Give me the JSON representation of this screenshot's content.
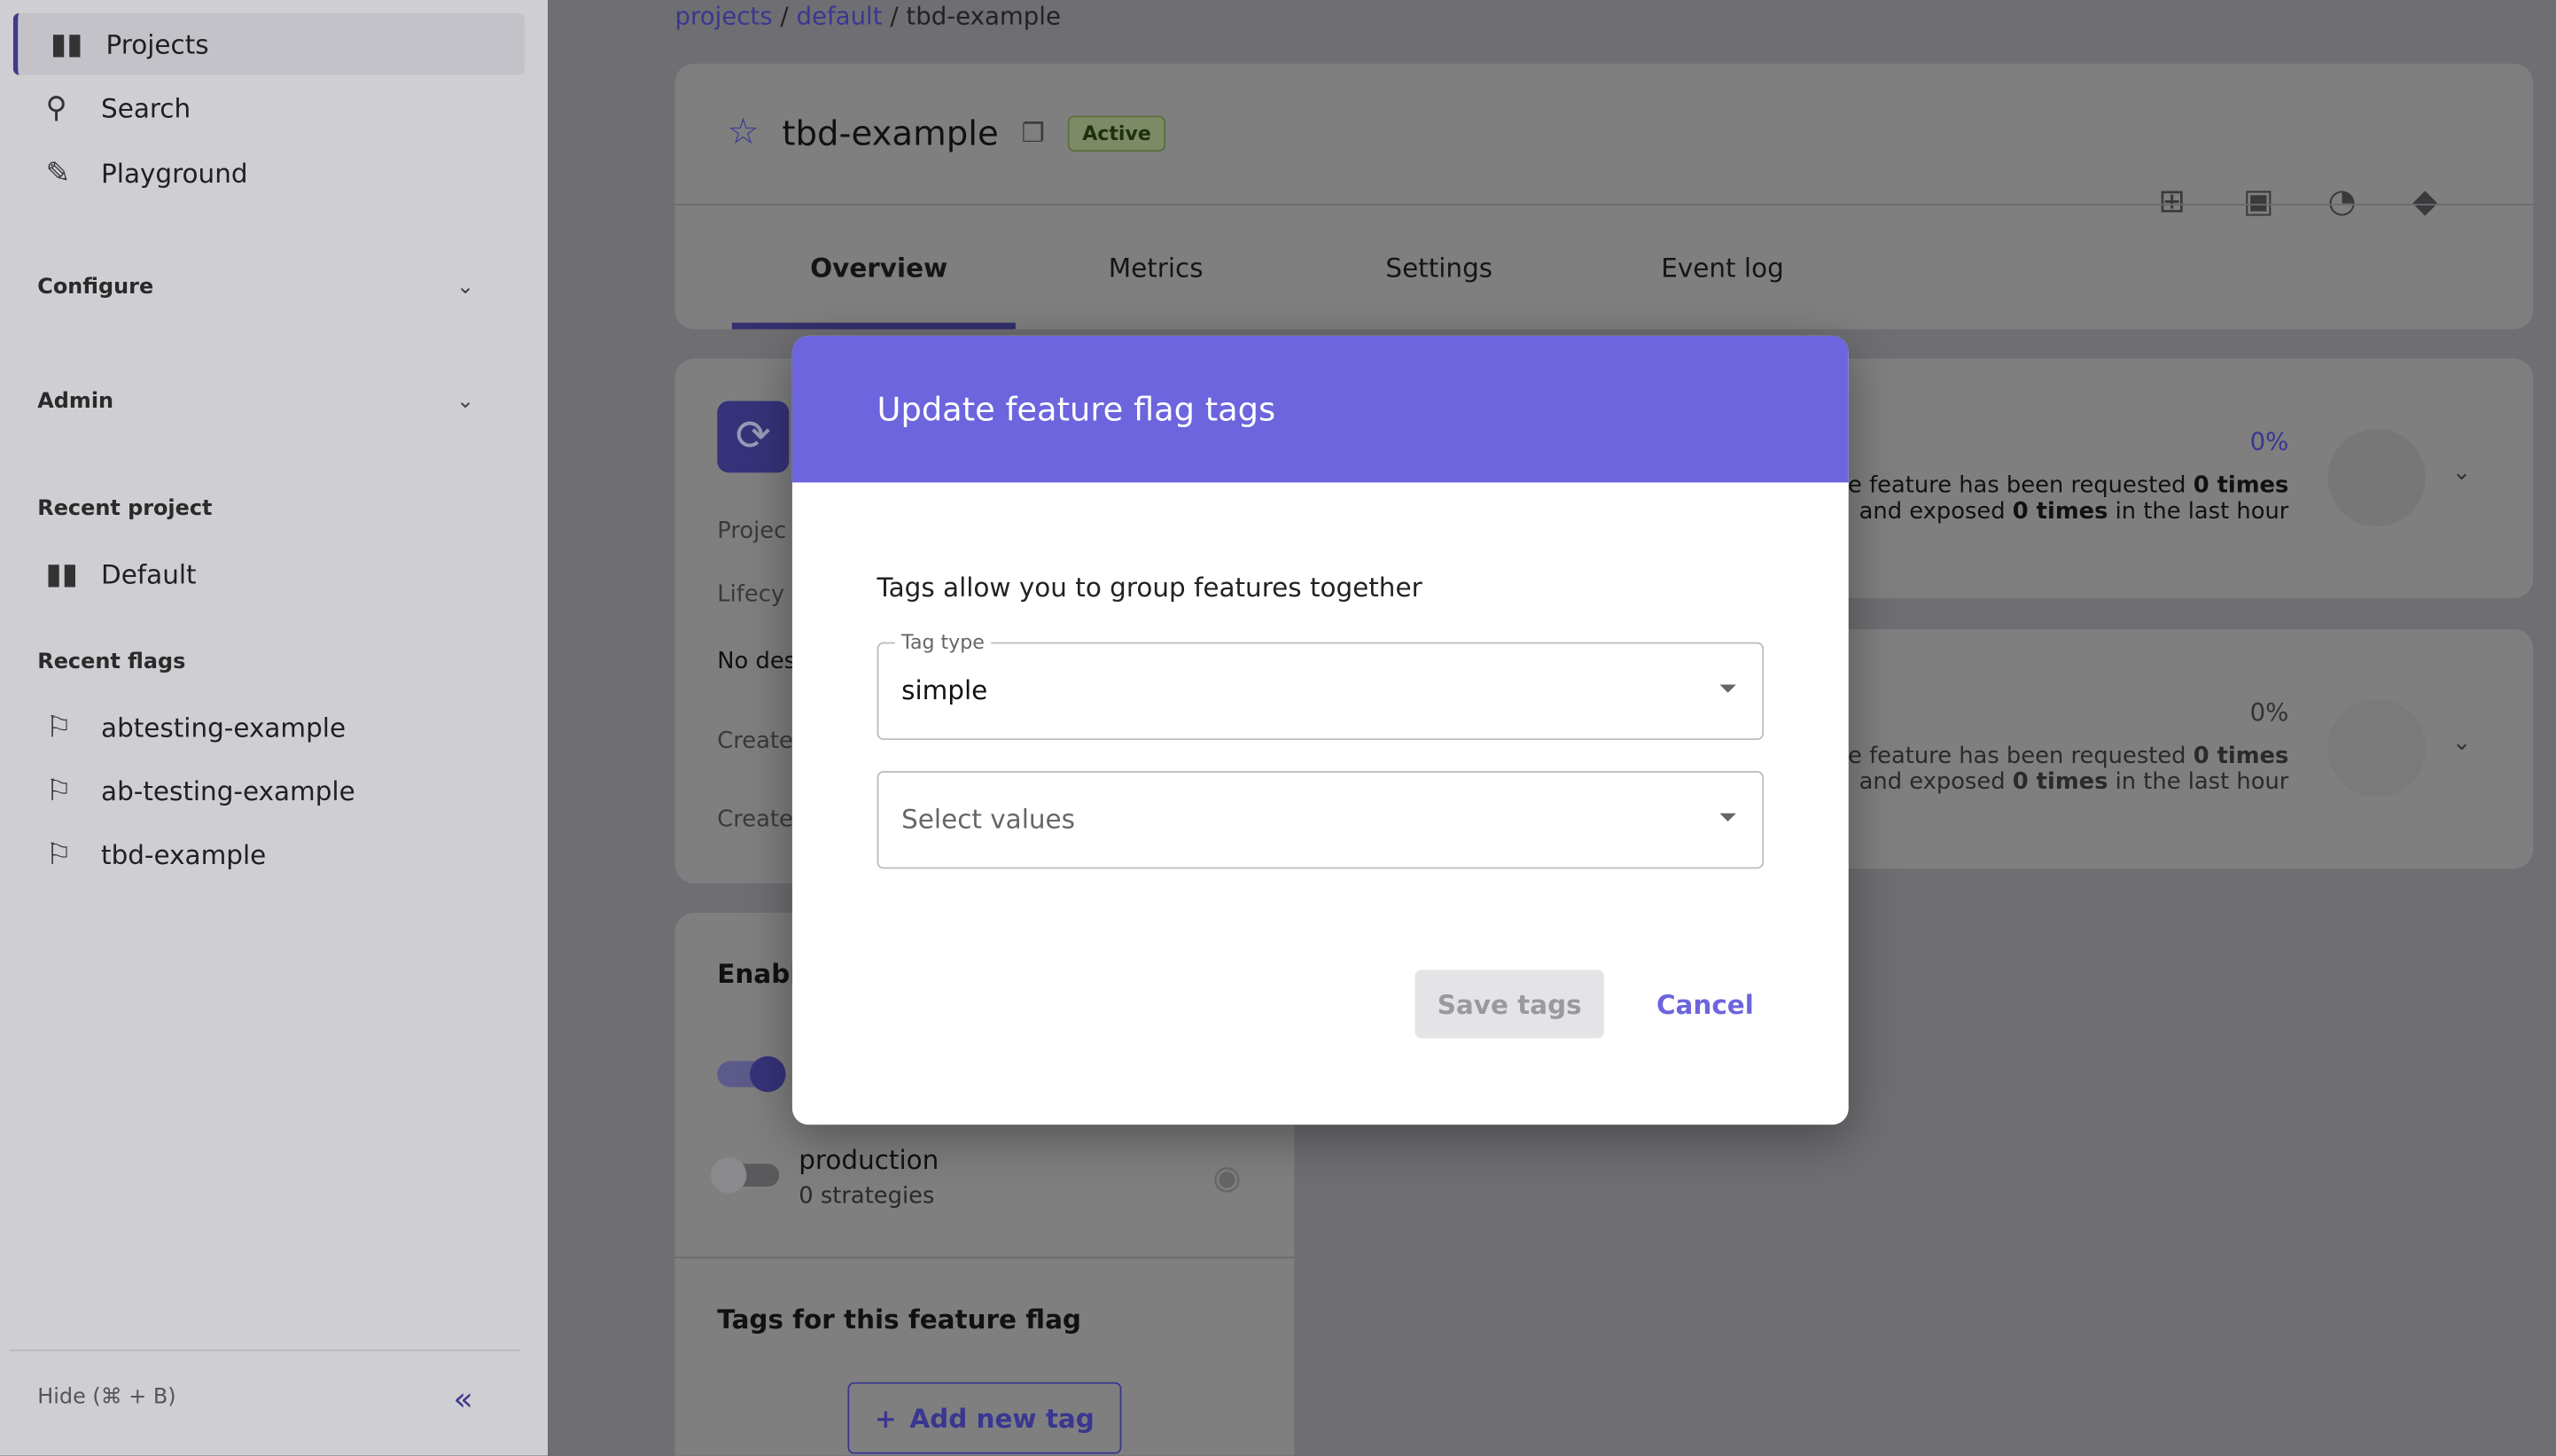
{
  "sidebar": {
    "nav": [
      {
        "label": "Projects",
        "icon": "projects-icon"
      },
      {
        "label": "Search",
        "icon": "search-icon"
      },
      {
        "label": "Playground",
        "icon": "playground-icon"
      }
    ],
    "configure": "Configure",
    "admin": "Admin",
    "recent_project_title": "Recent project",
    "recent_project": "Default",
    "recent_flags_title": "Recent flags",
    "recent_flags": [
      "abtesting-example",
      "ab-testing-example",
      "tbd-example"
    ],
    "hide": "Hide (⌘ + B)"
  },
  "breadcrumb": {
    "projects": "projects",
    "default": "default",
    "current": "tbd-example"
  },
  "header": {
    "title": "tbd-example",
    "status": "Active",
    "tabs": [
      "Overview",
      "Metrics",
      "Settings",
      "Event log"
    ],
    "active_tab": "Overview"
  },
  "details": {
    "project": "Projec",
    "lifecycle": "Lifecy",
    "description": "No des",
    "created1": "Create",
    "created2": "Create"
  },
  "env_metrics": [
    {
      "percent": "0%",
      "line1_pre": "e feature has been requested ",
      "line1_bold": "0 times",
      "line2_pre": "and exposed ",
      "line2_bold": "0 times",
      "line2_post": " in the last hour"
    },
    {
      "percent": "0%",
      "line1_pre": "e feature has been requested ",
      "line1_bold": "0 times",
      "line2_pre": "and exposed ",
      "line2_bold": "0 times",
      "line2_post": " in the last hour"
    }
  ],
  "environments": {
    "title": "Enabl",
    "items": [
      {
        "name": "production",
        "strategies": "0 strategies",
        "enabled": false
      }
    ],
    "first_enabled": true
  },
  "tags": {
    "title": "Tags for this feature flag",
    "add": "Add new tag"
  },
  "modal": {
    "title": "Update feature flag tags",
    "description": "Tags allow you to group features together",
    "tag_type_label": "Tag type",
    "tag_type_value": "simple",
    "values_placeholder": "Select values",
    "save": "Save tags",
    "cancel": "Cancel"
  },
  "colors": {
    "accent": "#6c65de",
    "primary": "#3d3a8c"
  }
}
